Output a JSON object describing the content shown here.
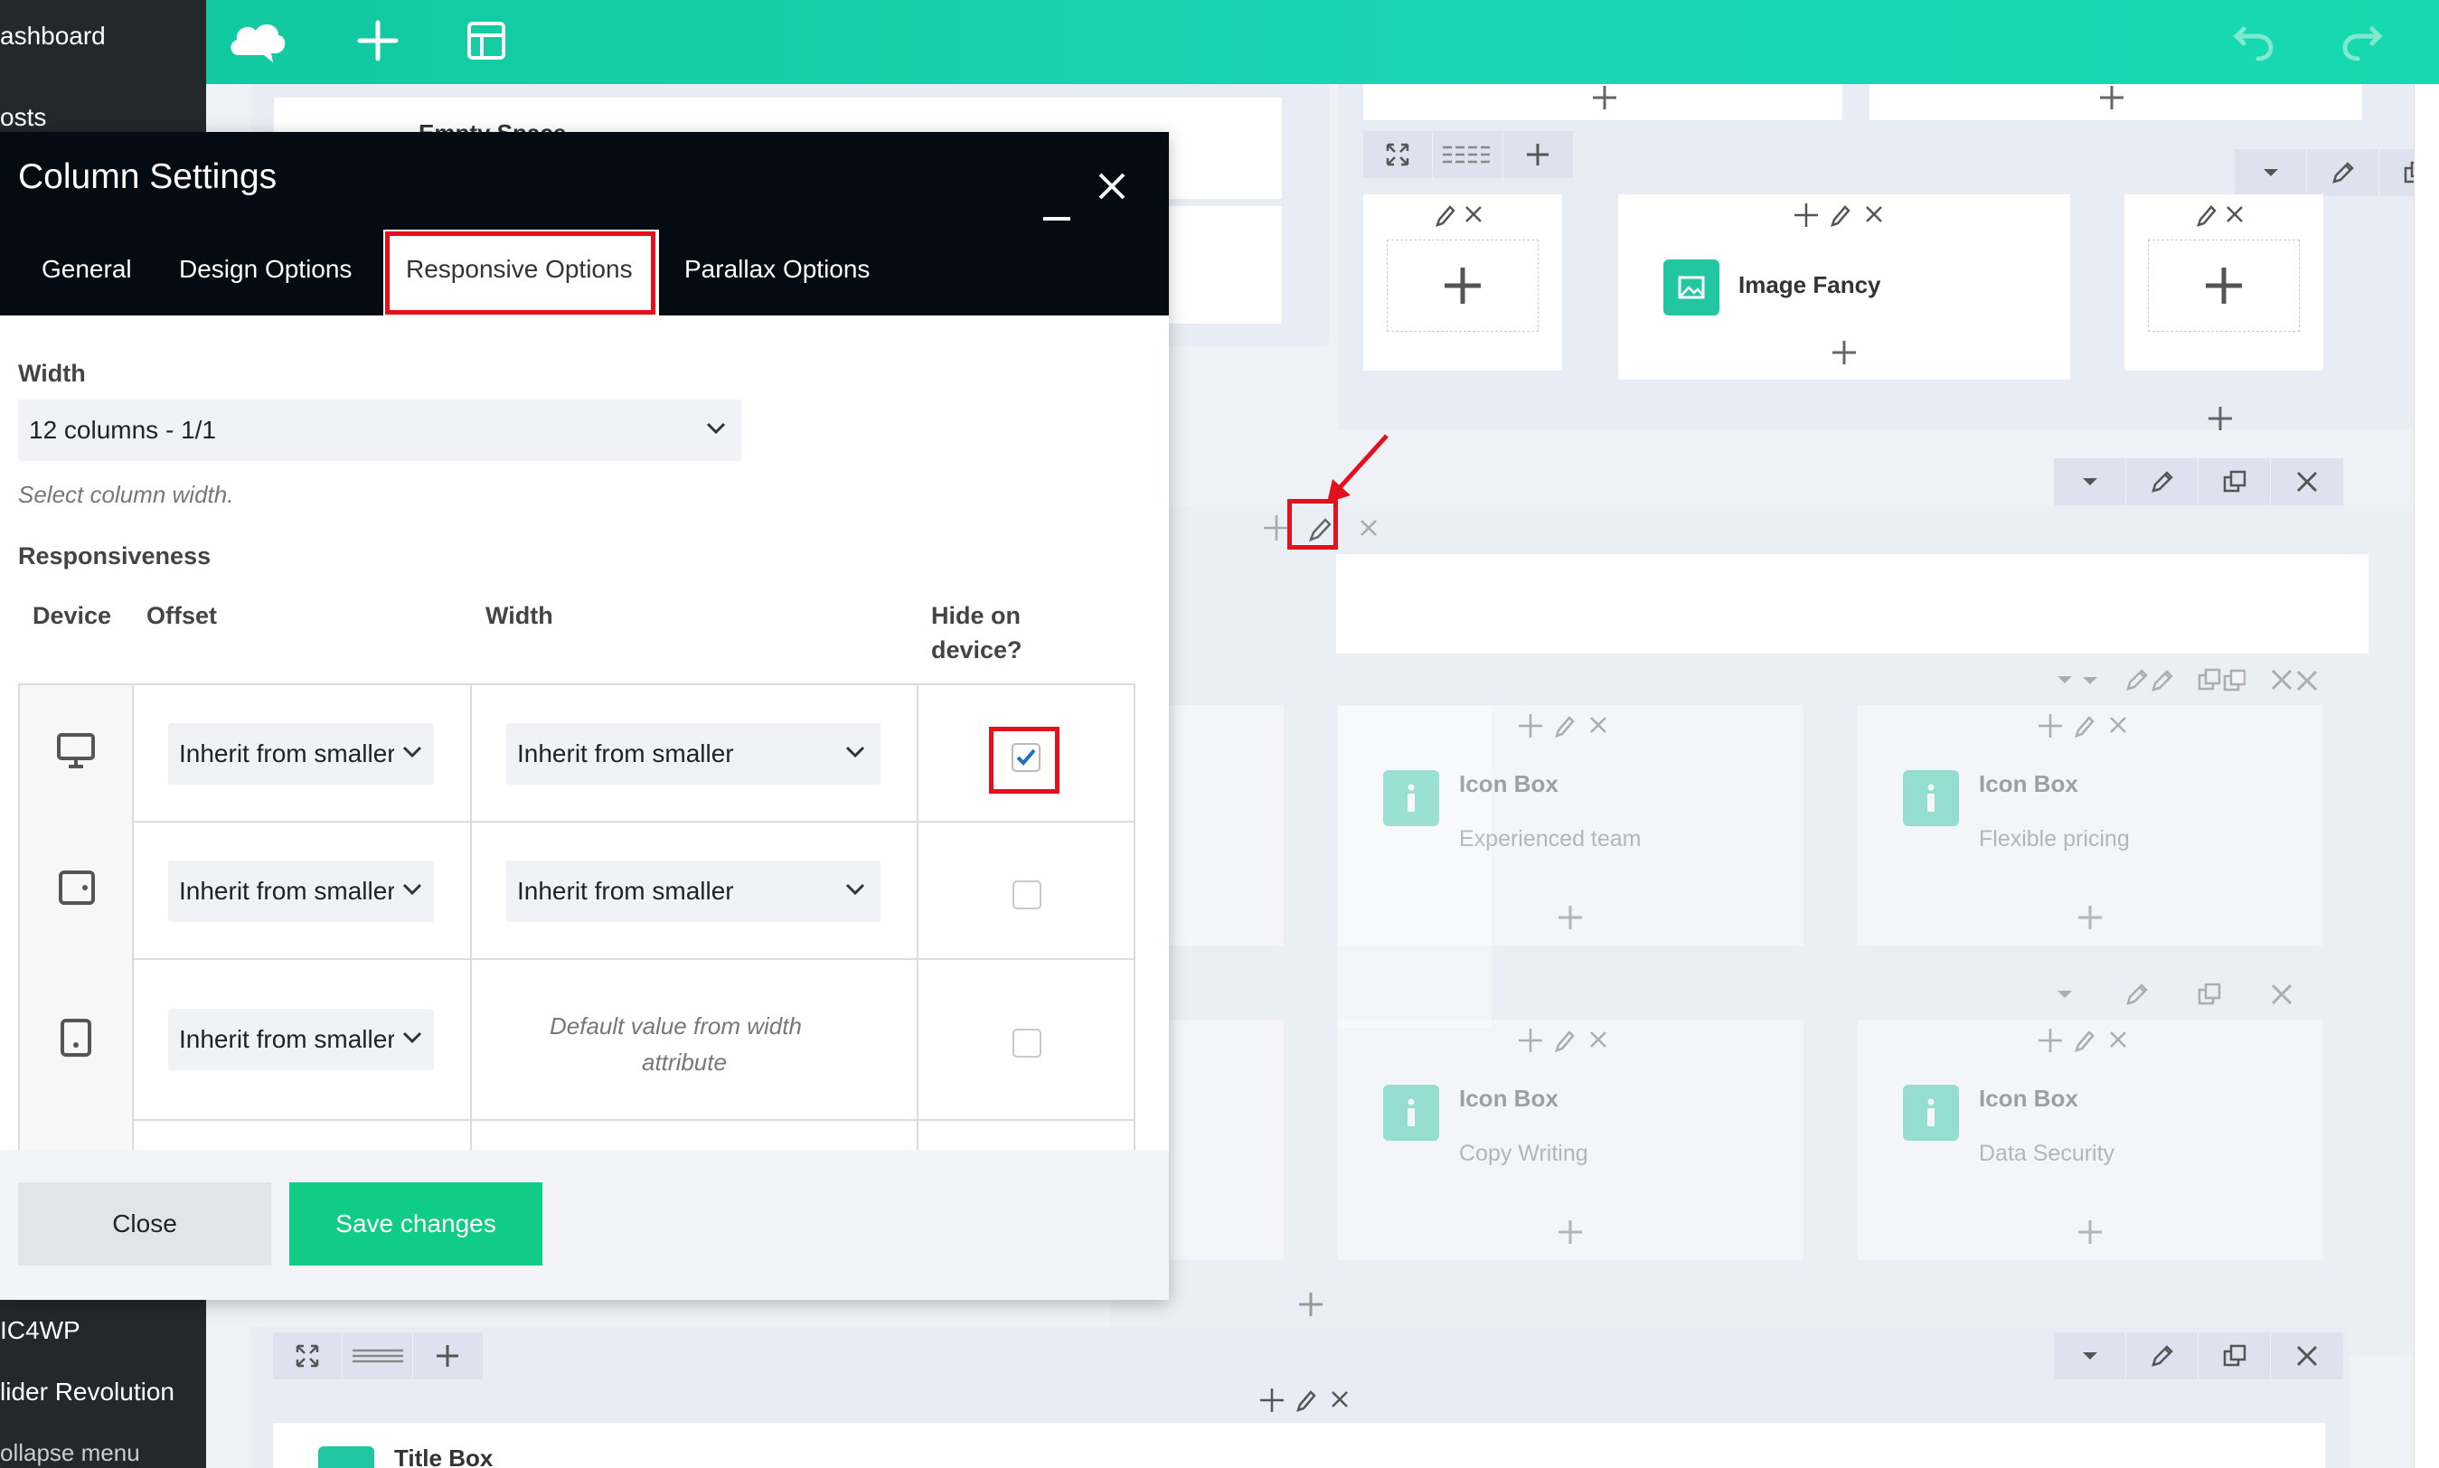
{
  "sidebar": {
    "items": [
      {
        "label": "ashboard"
      },
      {
        "label": "osts"
      },
      {
        "label": "IC4WP"
      },
      {
        "label": "lider Revolution"
      },
      {
        "label": "ollapse menu"
      }
    ]
  },
  "toolbar": {
    "icons": [
      "logo-cloud-icon",
      "add-element-icon",
      "templates-icon",
      "undo-icon",
      "redo-icon"
    ]
  },
  "canvas": {
    "empty_space_label": "Empty Space",
    "image_fancy_label": "Image Fancy",
    "icon_boxes": [
      {
        "title": "Icon Box",
        "subtitle": "Experienced team"
      },
      {
        "title": "Icon Box",
        "subtitle": "Flexible pricing"
      },
      {
        "title": "Icon Box",
        "subtitle": "Copy Writing"
      },
      {
        "title": "Icon Box",
        "subtitle": "Data Security"
      }
    ],
    "title_box_label": "Title Box"
  },
  "modal": {
    "title": "Column Settings",
    "tabs": [
      {
        "label": "General"
      },
      {
        "label": "Design Options"
      },
      {
        "label": "Responsive Options",
        "active": true
      },
      {
        "label": "Parallax Options"
      }
    ],
    "width_label": "Width",
    "width_value": "12 columns - 1/1",
    "width_hint": "Select column width.",
    "responsiveness_label": "Responsiveness",
    "columns": {
      "device": "Device",
      "offset": "Offset",
      "width": "Width",
      "hide_line1": "Hide on",
      "hide_line2": "device?"
    },
    "rows": [
      {
        "device": "desktop-icon",
        "offset": "Inherit from smaller",
        "width": "Inherit from smaller",
        "hidden": true
      },
      {
        "device": "tablet-landscape-icon",
        "offset": "Inherit from smaller",
        "width": "Inherit from smaller",
        "hidden": false
      },
      {
        "device": "tablet-portrait-icon",
        "offset": "Inherit from smaller",
        "width_line1": "Default value from width",
        "width_line2": "attribute",
        "hidden": false
      }
    ],
    "close_label": "Close",
    "save_label": "Save changes"
  },
  "colors": {
    "accent": "#10cc85",
    "toolbar": "#15d3ad",
    "highlight": "#e4101b",
    "modal_header": "#050b12"
  }
}
